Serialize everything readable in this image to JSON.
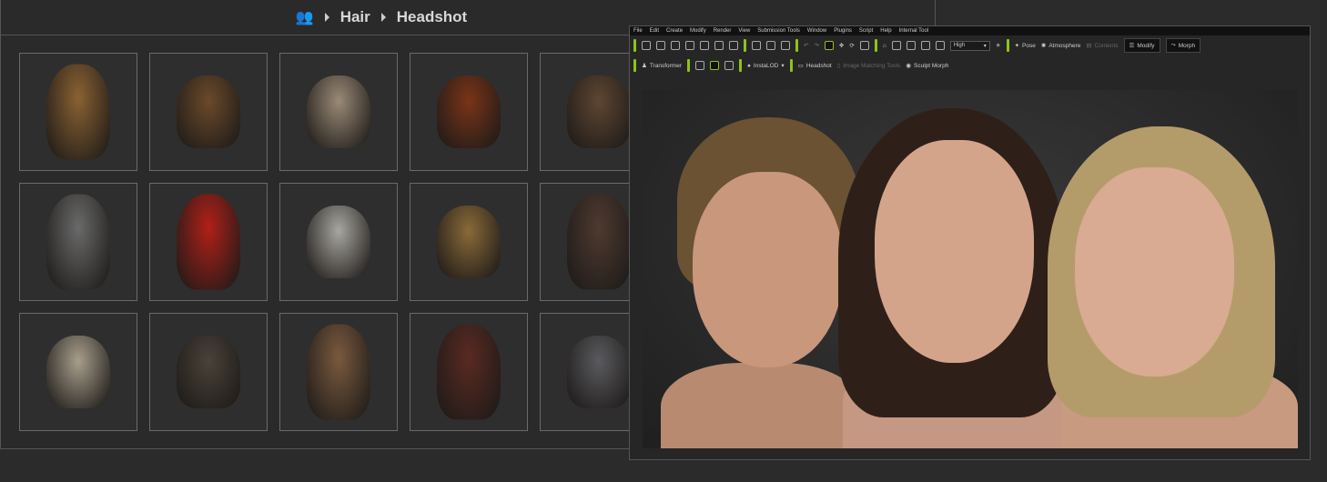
{
  "library": {
    "breadcrumb": [
      "Hair",
      "Headshot"
    ],
    "icon": "characters-icon",
    "items": [
      {
        "color": "#8a6232"
      },
      {
        "color": "#6b4a2a"
      },
      {
        "color": "#9a8a76"
      },
      {
        "color": "#7a3418"
      },
      {
        "color": "#5e4632"
      },
      {
        "color": "#6a6a6a"
      },
      {
        "color": "#b02018"
      },
      {
        "color": "#a8a6a0"
      },
      {
        "color": "#8a6a38"
      },
      {
        "color": "#4e3a30"
      },
      {
        "color": "#a89e8c"
      },
      {
        "color": "#4a4238"
      },
      {
        "color": "#7a5a3e"
      },
      {
        "color": "#5a2a22"
      },
      {
        "color": "#5a5a5e"
      }
    ]
  },
  "app": {
    "menu": [
      "File",
      "Edit",
      "Create",
      "Modify",
      "Render",
      "View",
      "Submission Tools",
      "Window",
      "Plugins",
      "Script",
      "Help",
      "Internal Tool"
    ],
    "toolbar": {
      "quality": "High",
      "pose": "Pose",
      "atmosphere": "Atmosphere",
      "contents": "Contents",
      "modify": "Modify",
      "morph": "Morph",
      "transformer": "Transformer",
      "instalod": "InstaLOD",
      "headshot": "Headshot",
      "image_matching": "Image Matching Tools",
      "sculpt_morph": "Sculpt Morph"
    },
    "accent": "#8dc21f"
  }
}
